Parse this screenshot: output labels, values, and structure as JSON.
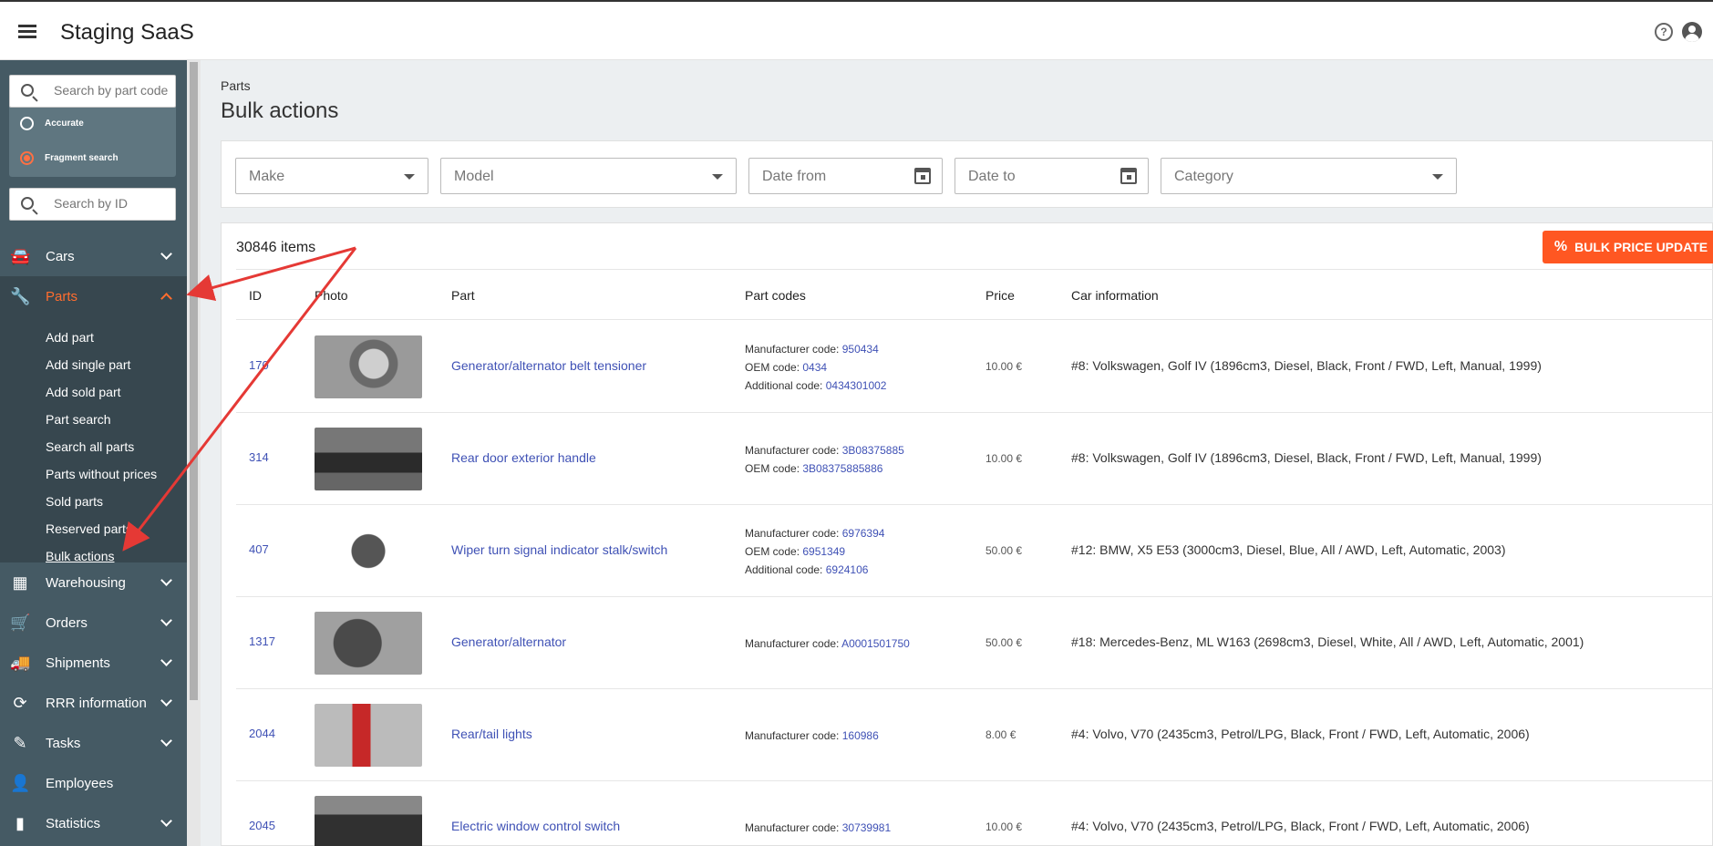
{
  "app": {
    "title": "Staging SaaS"
  },
  "sidebar": {
    "part_search_placeholder": "Search by part code",
    "radio_accurate": "Accurate",
    "radio_fragment": "Fragment search",
    "id_search_placeholder": "Search by ID",
    "nav": [
      {
        "label": "Cars",
        "icon": "car-icon"
      },
      {
        "label": "Parts",
        "icon": "wrench-icon"
      },
      {
        "label": "Warehousing",
        "icon": "warehouse-icon"
      },
      {
        "label": "Orders",
        "icon": "cart-icon"
      },
      {
        "label": "Shipments",
        "icon": "truck-icon"
      },
      {
        "label": "RRR information",
        "icon": "recycle-icon"
      },
      {
        "label": "Tasks",
        "icon": "task-icon"
      },
      {
        "label": "Employees",
        "icon": "employee-icon"
      },
      {
        "label": "Statistics",
        "icon": "chart-icon"
      }
    ],
    "parts_submenu": [
      "Add part",
      "Add single part",
      "Add sold part",
      "Part search",
      "Search all parts",
      "Parts without prices",
      "Sold parts",
      "Reserved parts",
      "Bulk actions"
    ]
  },
  "page": {
    "breadcrumb": "Parts",
    "title": "Bulk actions",
    "filters": {
      "make": "Make",
      "model": "Model",
      "date_from": "Date from",
      "date_to": "Date to",
      "category": "Category"
    },
    "count": "30846 items",
    "bulk_button": "BULK PRICE UPDATE",
    "columns": {
      "id": "ID",
      "photo": "Photo",
      "part": "Part",
      "part_codes": "Part codes",
      "price": "Price",
      "car_info": "Car information"
    },
    "rows": [
      {
        "id": "170",
        "part": "Generator/alternator belt tensioner",
        "codes": [
          {
            "label": "Manufacturer code:",
            "value": "950434"
          },
          {
            "label": "OEM code:",
            "value": "0434"
          },
          {
            "label": "Additional code:",
            "value": "0434301002"
          }
        ],
        "price": "10.00 €",
        "car": "#8: Volkswagen, Golf IV (1896cm3, Diesel, Black, Front / FWD, Left, Manual, 1999)"
      },
      {
        "id": "314",
        "part": "Rear door exterior handle",
        "codes": [
          {
            "label": "Manufacturer code:",
            "value": "3B08375885"
          },
          {
            "label": "OEM code:",
            "value": "3B08375885886"
          }
        ],
        "price": "10.00 €",
        "car": "#8: Volkswagen, Golf IV (1896cm3, Diesel, Black, Front / FWD, Left, Manual, 1999)"
      },
      {
        "id": "407",
        "part": "Wiper turn signal indicator stalk/switch",
        "codes": [
          {
            "label": "Manufacturer code:",
            "value": "6976394"
          },
          {
            "label": "OEM code:",
            "value": "6951349"
          },
          {
            "label": "Additional code:",
            "value": "6924106"
          }
        ],
        "price": "50.00 €",
        "car": "#12: BMW, X5 E53 (3000cm3, Diesel, Blue, All / AWD, Left, Automatic, 2003)"
      },
      {
        "id": "1317",
        "part": "Generator/alternator",
        "codes": [
          {
            "label": "Manufacturer code:",
            "value": "A0001501750"
          }
        ],
        "price": "50.00 €",
        "car": "#18: Mercedes-Benz, ML W163 (2698cm3, Diesel, White, All / AWD, Left, Automatic, 2001)"
      },
      {
        "id": "2044",
        "part": "Rear/tail lights",
        "codes": [
          {
            "label": "Manufacturer code:",
            "value": "160986"
          }
        ],
        "price": "8.00 €",
        "car": "#4: Volvo, V70 (2435cm3, Petrol/LPG, Black, Front / FWD, Left, Automatic, 2006)"
      },
      {
        "id": "2045",
        "part": "Electric window control switch",
        "codes": [
          {
            "label": "Manufacturer code:",
            "value": "30739981"
          }
        ],
        "price": "10.00 €",
        "car": "#4: Volvo, V70 (2435cm3, Petrol/LPG, Black, Front / FWD, Left, Automatic, 2006)"
      }
    ]
  },
  "colors": {
    "sidebar": "#455a64",
    "accent": "#ff5722",
    "link": "#3f51b5",
    "annotation": "#e53935"
  }
}
